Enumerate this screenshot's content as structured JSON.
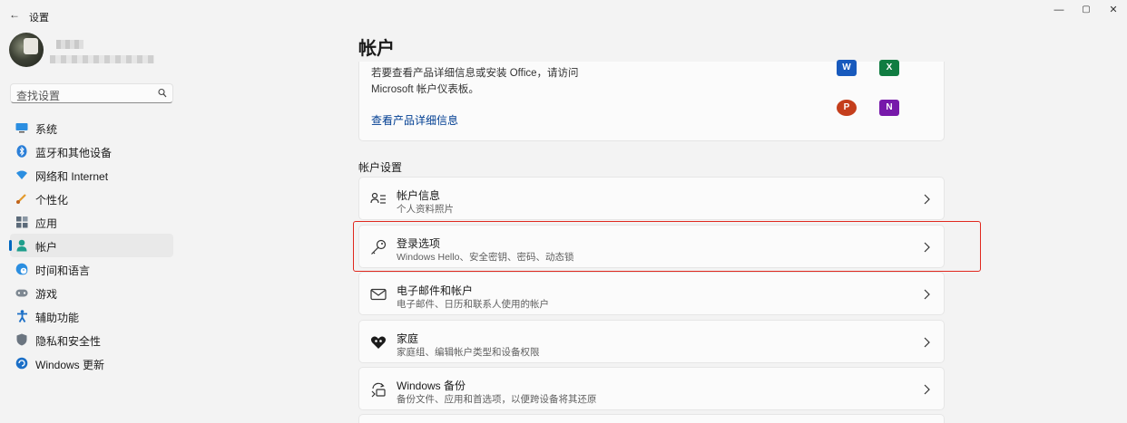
{
  "window": {
    "title": "设置",
    "back_glyph": "←",
    "minimize_glyph": "—",
    "maximize_glyph": "▢",
    "close_glyph": "✕"
  },
  "search": {
    "placeholder": "查找设置"
  },
  "sidebar": {
    "items": [
      {
        "label": "系统",
        "icon": "monitor-icon",
        "active": false
      },
      {
        "label": "蓝牙和其他设备",
        "icon": "bluetooth-icon",
        "active": false
      },
      {
        "label": "网络和 Internet",
        "icon": "wifi-icon",
        "active": false
      },
      {
        "label": "个性化",
        "icon": "brush-icon",
        "active": false
      },
      {
        "label": "应用",
        "icon": "apps-icon",
        "active": false
      },
      {
        "label": "帐户",
        "icon": "person-icon",
        "active": true
      },
      {
        "label": "时间和语言",
        "icon": "globe-clock-icon",
        "active": false
      },
      {
        "label": "游戏",
        "icon": "gamepad-icon",
        "active": false
      },
      {
        "label": "辅助功能",
        "icon": "accessibility-icon",
        "active": false
      },
      {
        "label": "隐私和安全性",
        "icon": "shield-icon",
        "active": false
      },
      {
        "label": "Windows 更新",
        "icon": "update-icon",
        "active": false
      }
    ]
  },
  "main": {
    "page_title": "帐户",
    "office": {
      "description_line1": "若要查看产品详细信息或安装 Office，请访问",
      "description_line2": "Microsoft 帐户仪表板。",
      "link": "查看产品详细信息",
      "apps": [
        {
          "name": "word-icon",
          "letter": "W",
          "color": "#185abd"
        },
        {
          "name": "excel-icon",
          "letter": "X",
          "color": "#107c41"
        },
        {
          "name": "powerpoint-icon",
          "letter": "P",
          "color": "#c43e1c"
        },
        {
          "name": "onenote-icon",
          "letter": "N",
          "color": "#7719aa"
        }
      ]
    },
    "section_title": "帐户设置",
    "rows": [
      {
        "title": "帐户信息",
        "subtitle": "个人资料照片",
        "icon": "person-card-icon"
      },
      {
        "title": "登录选项",
        "subtitle": "Windows Hello、安全密钥、密码、动态锁",
        "icon": "key-icon"
      },
      {
        "title": "电子邮件和帐户",
        "subtitle": "电子邮件、日历和联系人使用的帐户",
        "icon": "mail-icon"
      },
      {
        "title": "家庭",
        "subtitle": "家庭组、编辑帐户类型和设备权限",
        "icon": "heart-people-icon"
      },
      {
        "title": "Windows 备份",
        "subtitle": "备份文件、应用和首选项，以便跨设备将其还原",
        "icon": "backup-icon"
      }
    ]
  },
  "colors": {
    "accent": "#0067c0",
    "highlight": "#e0281e",
    "link": "#003e92"
  }
}
